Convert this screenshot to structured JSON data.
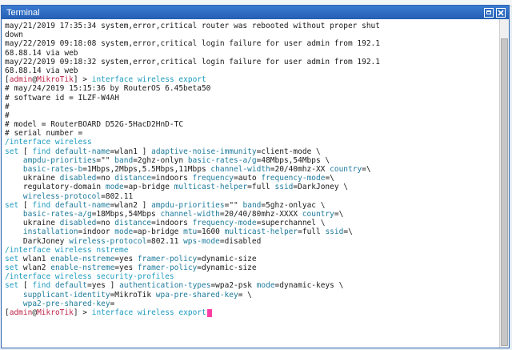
{
  "window": {
    "title": "Terminal"
  },
  "colors": {
    "default": "#1a1a1a",
    "cmd": "#1d9bc0",
    "prompt_user": "#c0264a",
    "key": "#1d7a9b",
    "value": "#1a1a1a",
    "section": "#1d9bc0",
    "keyword": "#1d9bc0",
    "cursor": "#ff3fa6"
  },
  "lines": [
    [
      [
        "may/21/2019 17:35:34 system,error,critical router was rebooted without proper shut",
        "d"
      ]
    ],
    [
      [
        "down",
        "d"
      ]
    ],
    [
      [
        "may/22/2019 09:18:08 system,error,critical login failure for user admin from 192.1",
        "d"
      ]
    ],
    [
      [
        "68.88.14 via web",
        "d"
      ]
    ],
    [
      [
        "may/22/2019 09:18:32 system,error,critical login failure for user admin from 192.1",
        "d"
      ]
    ],
    [
      [
        "68.88.14 via web",
        "d"
      ]
    ],
    [
      [
        "[",
        "d"
      ],
      [
        "admin",
        "p"
      ],
      [
        "@",
        "d"
      ],
      [
        "MikroTik",
        "p"
      ],
      [
        "] > ",
        "d"
      ],
      [
        "interface wireless export",
        "c"
      ]
    ],
    [
      [
        "# may/24/2019 15:15:36 by RouterOS 6.45beta50",
        "d"
      ]
    ],
    [
      [
        "# software id = ILZF-W4AH",
        "d"
      ]
    ],
    [
      [
        "#",
        "d"
      ]
    ],
    [
      [
        "#",
        "d"
      ]
    ],
    [
      [
        "# model = RouterBOARD D52G-5HacD2HnD-TC",
        "d"
      ]
    ],
    [
      [
        "# serial number = ",
        "d"
      ]
    ],
    [
      [
        "/interface wireless",
        "c"
      ]
    ],
    [
      [
        "set",
        "c"
      ],
      [
        " [ ",
        "d"
      ],
      [
        "find",
        "c"
      ],
      [
        " ",
        "d"
      ],
      [
        "default-name",
        "k"
      ],
      [
        "=wlan1 ] ",
        "d"
      ],
      [
        "adaptive-noise-immunity",
        "k"
      ],
      [
        "=client-mode \\",
        "d"
      ]
    ],
    [
      [
        "    ",
        "d"
      ],
      [
        "ampdu-priorities",
        "k"
      ],
      [
        "=\"\" ",
        "d"
      ],
      [
        "band",
        "k"
      ],
      [
        "=2ghz-onlyn ",
        "d"
      ],
      [
        "basic-rates-a/g",
        "k"
      ],
      [
        "=48Mbps,54Mbps \\",
        "d"
      ]
    ],
    [
      [
        "    ",
        "d"
      ],
      [
        "basic-rates-b",
        "k"
      ],
      [
        "=1Mbps,2Mbps,5.5Mbps,11Mbps ",
        "d"
      ],
      [
        "channel-width",
        "k"
      ],
      [
        "=20/40mhz-XX ",
        "d"
      ],
      [
        "country",
        "k"
      ],
      [
        "=\\",
        "d"
      ]
    ],
    [
      [
        "    ukraine ",
        "d"
      ],
      [
        "disabled",
        "k"
      ],
      [
        "=no ",
        "d"
      ],
      [
        "distance",
        "k"
      ],
      [
        "=indoors ",
        "d"
      ],
      [
        "frequency",
        "k"
      ],
      [
        "=auto ",
        "d"
      ],
      [
        "frequency-mode",
        "k"
      ],
      [
        "=\\",
        "d"
      ]
    ],
    [
      [
        "    regulatory-domain ",
        "d"
      ],
      [
        "mode",
        "k"
      ],
      [
        "=ap-bridge ",
        "d"
      ],
      [
        "multicast-helper",
        "k"
      ],
      [
        "=full ",
        "d"
      ],
      [
        "ssid",
        "k"
      ],
      [
        "=DarkJoney \\",
        "d"
      ]
    ],
    [
      [
        "    ",
        "d"
      ],
      [
        "wireless-protocol",
        "k"
      ],
      [
        "=802.11",
        "d"
      ]
    ],
    [
      [
        "set",
        "c"
      ],
      [
        " [ ",
        "d"
      ],
      [
        "find",
        "c"
      ],
      [
        " ",
        "d"
      ],
      [
        "default-name",
        "k"
      ],
      [
        "=wlan2 ] ",
        "d"
      ],
      [
        "ampdu-priorities",
        "k"
      ],
      [
        "=\"\" ",
        "d"
      ],
      [
        "band",
        "k"
      ],
      [
        "=5ghz-onlyac \\",
        "d"
      ]
    ],
    [
      [
        "    ",
        "d"
      ],
      [
        "basic-rates-a/g",
        "k"
      ],
      [
        "=18Mbps,54Mbps ",
        "d"
      ],
      [
        "channel-width",
        "k"
      ],
      [
        "=20/40/80mhz-XXXX ",
        "d"
      ],
      [
        "country",
        "k"
      ],
      [
        "=\\",
        "d"
      ]
    ],
    [
      [
        "    ukraine ",
        "d"
      ],
      [
        "disabled",
        "k"
      ],
      [
        "=no ",
        "d"
      ],
      [
        "distance",
        "k"
      ],
      [
        "=indoors ",
        "d"
      ],
      [
        "frequency-mode",
        "k"
      ],
      [
        "=superchannel \\",
        "d"
      ]
    ],
    [
      [
        "    ",
        "d"
      ],
      [
        "installation",
        "k"
      ],
      [
        "=indoor ",
        "d"
      ],
      [
        "mode",
        "k"
      ],
      [
        "=ap-bridge ",
        "d"
      ],
      [
        "mtu",
        "k"
      ],
      [
        "=1600 ",
        "d"
      ],
      [
        "multicast-helper",
        "k"
      ],
      [
        "=full ",
        "d"
      ],
      [
        "ssid",
        "k"
      ],
      [
        "=\\",
        "d"
      ]
    ],
    [
      [
        "    DarkJoney ",
        "d"
      ],
      [
        "wireless-protocol",
        "k"
      ],
      [
        "=802.11 ",
        "d"
      ],
      [
        "wps-mode",
        "k"
      ],
      [
        "=disabled",
        "d"
      ]
    ],
    [
      [
        "/interface wireless nstreme",
        "c"
      ]
    ],
    [
      [
        "set",
        "c"
      ],
      [
        " wlan1 ",
        "d"
      ],
      [
        "enable-nstreme",
        "k"
      ],
      [
        "=yes ",
        "d"
      ],
      [
        "framer-policy",
        "k"
      ],
      [
        "=dynamic-size",
        "d"
      ]
    ],
    [
      [
        "set",
        "c"
      ],
      [
        " wlan2 ",
        "d"
      ],
      [
        "enable-nstreme",
        "k"
      ],
      [
        "=yes ",
        "d"
      ],
      [
        "framer-policy",
        "k"
      ],
      [
        "=dynamic-size",
        "d"
      ]
    ],
    [
      [
        "/interface wireless security-profiles",
        "c"
      ]
    ],
    [
      [
        "set",
        "c"
      ],
      [
        " [ ",
        "d"
      ],
      [
        "find",
        "c"
      ],
      [
        " ",
        "d"
      ],
      [
        "default",
        "k"
      ],
      [
        "=yes ] ",
        "d"
      ],
      [
        "authentication-types",
        "k"
      ],
      [
        "=wpa2-psk ",
        "d"
      ],
      [
        "mode",
        "k"
      ],
      [
        "=dynamic-keys \\",
        "d"
      ]
    ],
    [
      [
        "    ",
        "d"
      ],
      [
        "supplicant-identity",
        "k"
      ],
      [
        "=MikroTik ",
        "d"
      ],
      [
        "wpa-pre-shared-key",
        "k"
      ],
      [
        "= \\",
        "d"
      ]
    ],
    [
      [
        "    ",
        "d"
      ],
      [
        "wpa2-pre-shared-key",
        "k"
      ],
      [
        "=",
        "d"
      ]
    ],
    [
      [
        "[",
        "d"
      ],
      [
        "admin",
        "p"
      ],
      [
        "@",
        "d"
      ],
      [
        "MikroTik",
        "p"
      ],
      [
        "] > ",
        "d"
      ],
      [
        "interface wireless export",
        "c"
      ],
      [
        "",
        "cursor"
      ]
    ]
  ]
}
